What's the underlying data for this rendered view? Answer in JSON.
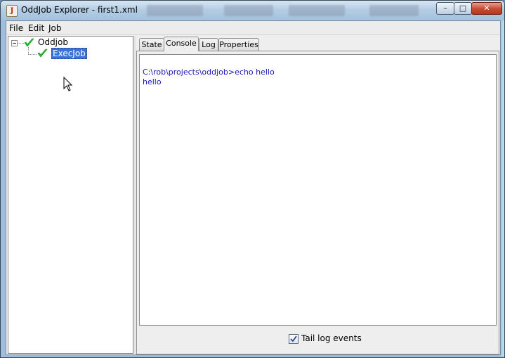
{
  "window": {
    "title": "OddJob Explorer - first1.xml",
    "app_icon": "java-cup-icon",
    "controls": {
      "minimize": "minimize-icon",
      "maximize": "maximize-icon",
      "close": "close-icon"
    }
  },
  "menubar": {
    "items": [
      {
        "label": "File"
      },
      {
        "label": "Edit"
      },
      {
        "label": "Job"
      }
    ]
  },
  "tree": {
    "root": {
      "label": "Oddjob",
      "status_icon": "green-check-icon",
      "expanded": true
    },
    "children": [
      {
        "label": "ExecJob",
        "status_icon": "green-check-icon",
        "selected": true
      }
    ]
  },
  "tabs": {
    "items": [
      {
        "label": "State"
      },
      {
        "label": "Console"
      },
      {
        "label": "Log"
      },
      {
        "label": "Properties"
      }
    ],
    "active": "Console"
  },
  "console": {
    "lines": [
      "C:\\rob\\projects\\oddjob>echo hello",
      "hello"
    ],
    "text_color": "#1818b8"
  },
  "tail_log": {
    "label": "Tail log events",
    "checked": true
  },
  "colors": {
    "selection": "#3875d7",
    "check": "#22c02a"
  }
}
